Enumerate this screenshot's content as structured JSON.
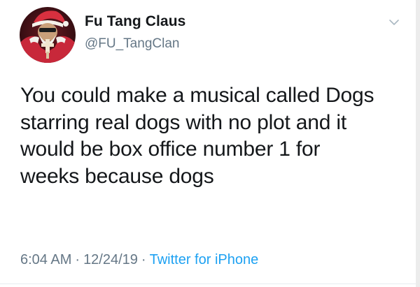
{
  "tweet": {
    "display_name": "Fu Tang Claus",
    "handle": "@FU_TangClan",
    "text_lines": [
      "You could make a musical called Dogs",
      "starring real dogs with no plot and it",
      "would be box office number 1 for",
      "weeks because dogs"
    ],
    "time": "6:04 AM",
    "date": "12/24/19",
    "separator": "·",
    "source": "Twitter for iPhone",
    "avatar_icon": "santa-avatar-icon",
    "menu_icon": "chevron-down-icon"
  },
  "colors": {
    "text": "#14171a",
    "secondary": "#657786",
    "link": "#1da1f2",
    "avatar_red": "#c8283a",
    "divider": "#e6ecf0"
  }
}
